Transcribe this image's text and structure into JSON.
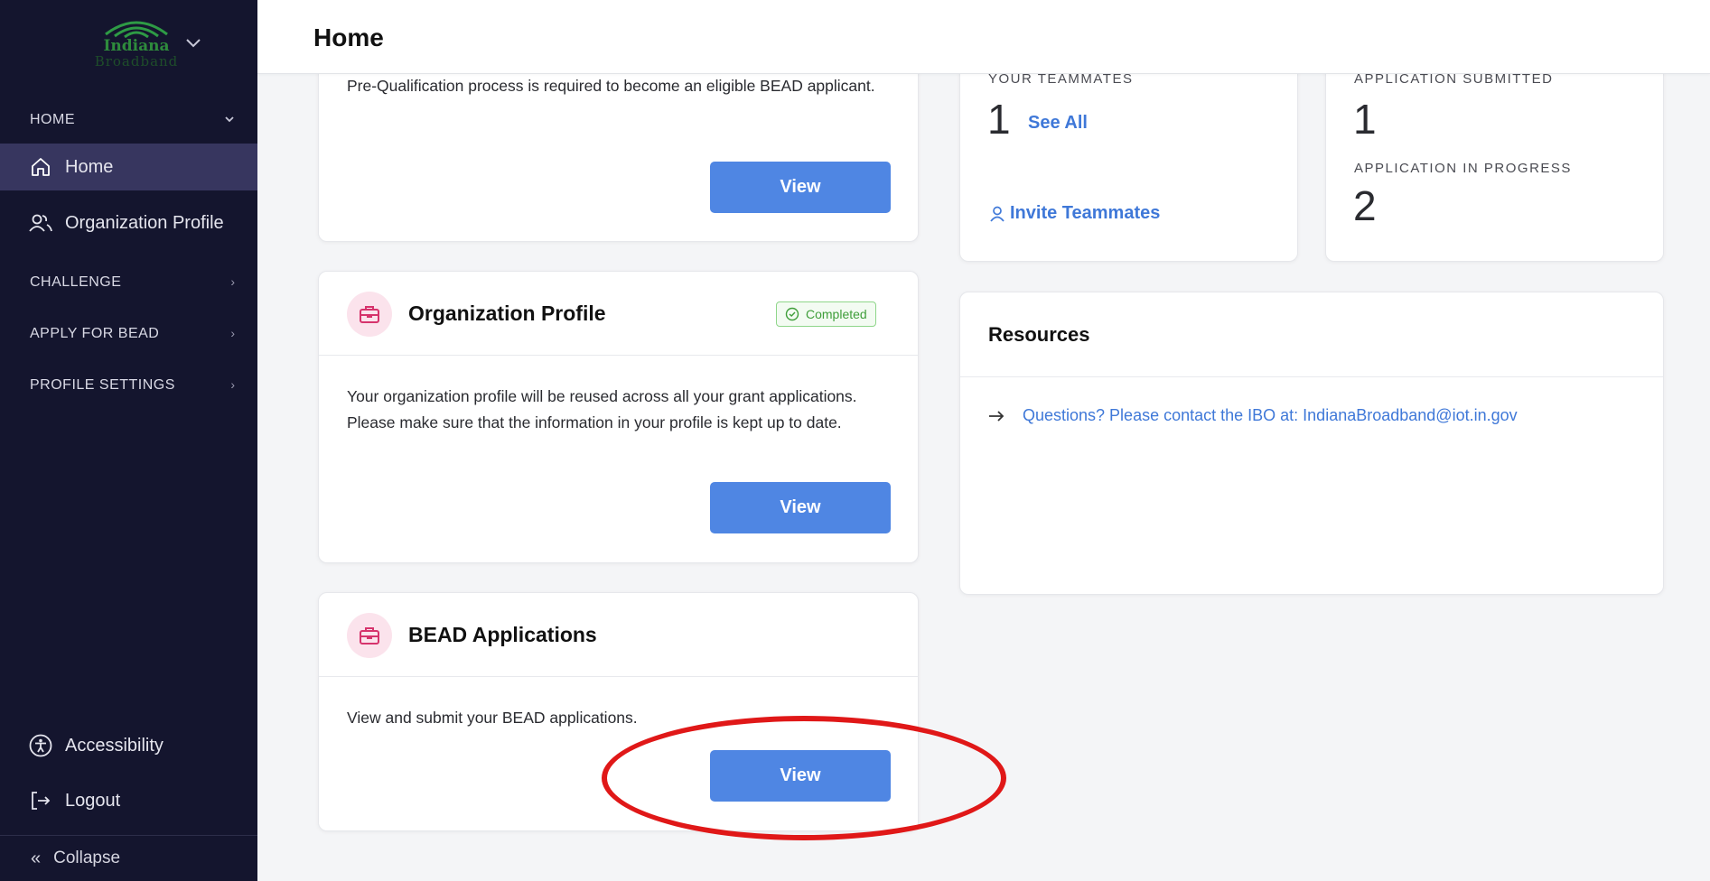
{
  "sidebar": {
    "logo": {
      "line1": "Indiana",
      "line2": "Broadband"
    },
    "home_section": "HOME",
    "items": [
      {
        "label": "Home",
        "icon": "home-icon"
      },
      {
        "label": "Organization Profile",
        "icon": "users-icon"
      }
    ],
    "sections": [
      {
        "label": "CHALLENGE"
      },
      {
        "label": "APPLY FOR BEAD"
      },
      {
        "label": "PROFILE SETTINGS"
      }
    ],
    "accessibility": "Accessibility",
    "logout": "Logout",
    "collapse": "Collapse"
  },
  "header": {
    "title": "Home"
  },
  "prequal_card": {
    "description": "Pre-Qualification process is required to become an eligible BEAD applicant.",
    "button": "View"
  },
  "org_card": {
    "title": "Organization Profile",
    "badge": "Completed",
    "description": "Your organization profile will be reused across all your grant applications. Please make sure that the information in your profile is kept up to date.",
    "button": "View"
  },
  "bead_card": {
    "title": "BEAD Applications",
    "description": "View and submit your BEAD applications.",
    "button": "View"
  },
  "teammates_card": {
    "label": "YOUR TEAMMATES",
    "count": "1",
    "see_all": "See All",
    "invite": "Invite Teammates"
  },
  "applications_card": {
    "submitted_label": "APPLICATION SUBMITTED",
    "submitted_value": "1",
    "in_progress_label": "APPLICATION IN PROGRESS",
    "in_progress_value": "2"
  },
  "resources_card": {
    "title": "Resources",
    "link": "Questions? Please contact the IBO at: IndianaBroadband@iot.in.gov"
  },
  "colors": {
    "sidebar_bg": "#14152e",
    "active_item": "#37365f",
    "primary_button": "#4f86e3",
    "link": "#3f78d8",
    "badge_green": "#3f9e3a",
    "annotation": "#e01818"
  }
}
